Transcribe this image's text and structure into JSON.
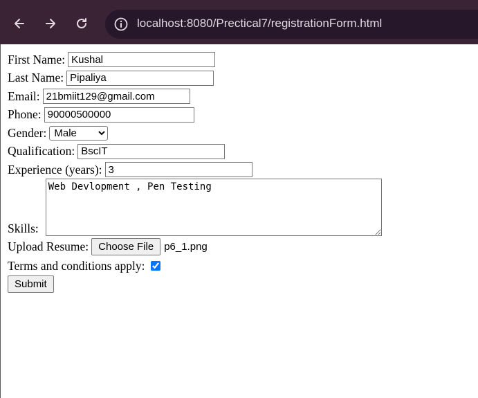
{
  "browser": {
    "url": "localhost:8080/Prectical7/registrationForm.html"
  },
  "form": {
    "first_name": {
      "label": "First Name:",
      "value": "Kushal"
    },
    "last_name": {
      "label": "Last Name:",
      "value": "Pipaliya"
    },
    "email": {
      "label": "Email:",
      "value": "21bmiit129@gmail.com"
    },
    "phone": {
      "label": "Phone:",
      "value": "90000500000"
    },
    "gender": {
      "label": "Gender:",
      "value": "Male"
    },
    "qualification": {
      "label": "Qualification:",
      "value": "BscIT"
    },
    "experience": {
      "label": "Experience (years):",
      "value": "3"
    },
    "skills": {
      "label": "Skills:",
      "value": "Web Devlopment , Pen Testing"
    },
    "resume": {
      "label": "Upload Resume:",
      "button": "Choose File",
      "filename": "p6_1.png"
    },
    "terms": {
      "label": "Terms and conditions apply:",
      "checked": true
    },
    "submit": "Submit"
  },
  "icons": [
    "back-arrow-icon",
    "forward-arrow-icon",
    "reload-icon",
    "site-info-icon"
  ],
  "colors": {
    "chrome": "#3a2335",
    "urlbar": "#26172a",
    "checkbox": "#0075ff"
  }
}
